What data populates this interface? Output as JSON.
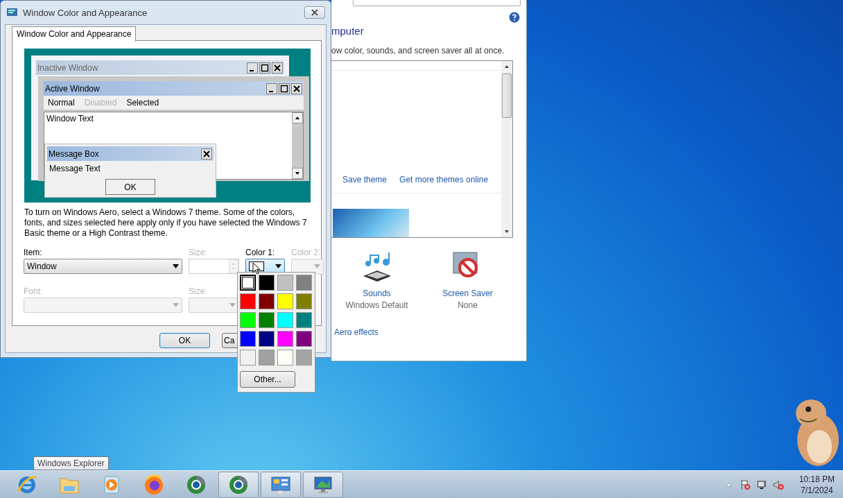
{
  "dialog": {
    "title": "Window Color and Appearance",
    "tabs": [
      {
        "label": "Window Color and Appearance",
        "selected": true
      }
    ],
    "preview": {
      "inactive_window": {
        "title": "Inactive Window"
      },
      "active_window": {
        "title": "Active Window",
        "menu": [
          {
            "label": "Normal",
            "kind": "normal"
          },
          {
            "label": "Disabled",
            "kind": "disabled"
          },
          {
            "label": "Selected",
            "kind": "selected"
          }
        ],
        "body_text": "Window Text"
      },
      "message_box": {
        "title": "Message Box",
        "text": "Message Text",
        "button": "OK"
      }
    },
    "description": "To turn on Windows Aero, select a Windows 7 theme.  Some of the colors, fonts, and sizes selected here apply only if you have selected the Windows 7 Basic theme or a High Contrast theme.",
    "item": {
      "label": "Item:",
      "value": "Window",
      "disabled": false
    },
    "item_size": {
      "label": "Size:",
      "disabled": true
    },
    "color_1": {
      "label": "Color 1:",
      "color": "#ffffff",
      "disabled": false,
      "expanded": true
    },
    "color_2": {
      "label": "Color 2:",
      "disabled": true
    },
    "font": {
      "label": "Font:",
      "disabled": true
    },
    "font_size": {
      "label": "Size:",
      "disabled": true
    },
    "buttons": [
      {
        "label": "OK",
        "kind": "default"
      },
      {
        "label": "Ca",
        "kind": "normal"
      }
    ]
  },
  "color_menu": {
    "swatches": [
      {
        "color": "#ffffff",
        "selected": true
      },
      {
        "color": "#000000",
        "selected": false
      },
      {
        "color": "#c0c0c0",
        "selected": false
      },
      {
        "color": "#808080",
        "selected": false
      },
      {
        "color": "#ff0000",
        "selected": false
      },
      {
        "color": "#800000",
        "selected": false
      },
      {
        "color": "#ffff00",
        "selected": false
      },
      {
        "color": "#808000",
        "selected": false
      },
      {
        "color": "#00ff00",
        "selected": false
      },
      {
        "color": "#008000",
        "selected": false
      },
      {
        "color": "#00ffff",
        "selected": false
      },
      {
        "color": "#008080",
        "selected": false
      },
      {
        "color": "#0000ff",
        "selected": false
      },
      {
        "color": "#000080",
        "selected": false
      },
      {
        "color": "#ff00ff",
        "selected": false
      },
      {
        "color": "#800080",
        "selected": false
      },
      {
        "color": "#f0f0f0",
        "selected": false
      },
      {
        "color": "#a0a0a0",
        "selected": false
      },
      {
        "color": "#fffff8",
        "selected": false
      },
      {
        "color": "#a4a4a4",
        "selected": false
      }
    ],
    "other_button": "Other..."
  },
  "personalization": {
    "heading": "mputer",
    "description": "ow color, sounds, and screen saver all at once.",
    "links": [
      "Save theme",
      "Get more themes online"
    ],
    "settings": [
      {
        "kind": "sounds",
        "label": "Sounds",
        "value": "Windows Default"
      },
      {
        "kind": "screensaver",
        "label": "Screen Saver",
        "value": "None"
      }
    ],
    "aero_link": "Aero effects"
  },
  "tooltip": "Windows Explorer",
  "taskbar": {
    "apps": [
      {
        "kind": "ie",
        "running": false
      },
      {
        "kind": "folder",
        "running": false
      },
      {
        "kind": "media",
        "running": false
      },
      {
        "kind": "firefox",
        "running": false
      },
      {
        "kind": "chrome",
        "running": false
      },
      {
        "kind": "chrome",
        "running": true
      },
      {
        "kind": "control",
        "running": true
      },
      {
        "kind": "display",
        "running": true
      }
    ],
    "clock": {
      "time": "10:18 PM",
      "date": "7/1/2024"
    }
  }
}
